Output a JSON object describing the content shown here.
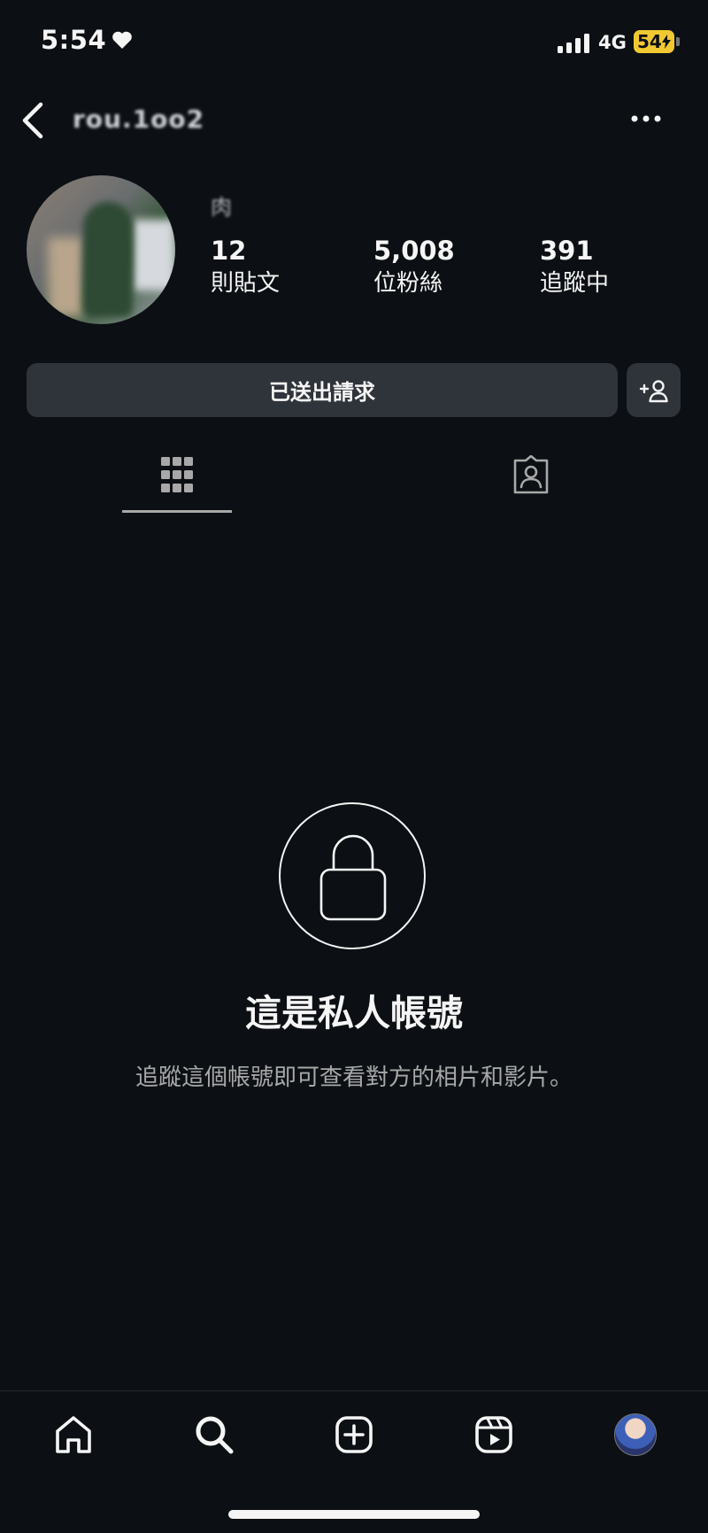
{
  "status_bar": {
    "time": "5:54",
    "network": "4G",
    "battery": "54"
  },
  "header": {
    "username": "rou.1oo2"
  },
  "profile": {
    "display_name": "肉",
    "stats": [
      {
        "value": "12",
        "label": "則貼文"
      },
      {
        "value": "5,008",
        "label": "位粉絲"
      },
      {
        "value": "391",
        "label": "追蹤中"
      }
    ]
  },
  "actions": {
    "request_label": "已送出請求"
  },
  "tabs": {
    "active": "grid",
    "items": [
      "grid-icon",
      "tagged-icon"
    ]
  },
  "private_notice": {
    "title": "這是私人帳號",
    "subtitle": "追蹤這個帳號即可查看對方的相片和影片。"
  },
  "bottom_nav": {
    "items": [
      "home-icon",
      "search-icon",
      "create-icon",
      "reels-icon",
      "profile-avatar"
    ]
  },
  "colors": {
    "background": "#0c1014",
    "button": "#2f333a",
    "battery": "#f2c832",
    "secondary_text": "#a8a8a8"
  }
}
